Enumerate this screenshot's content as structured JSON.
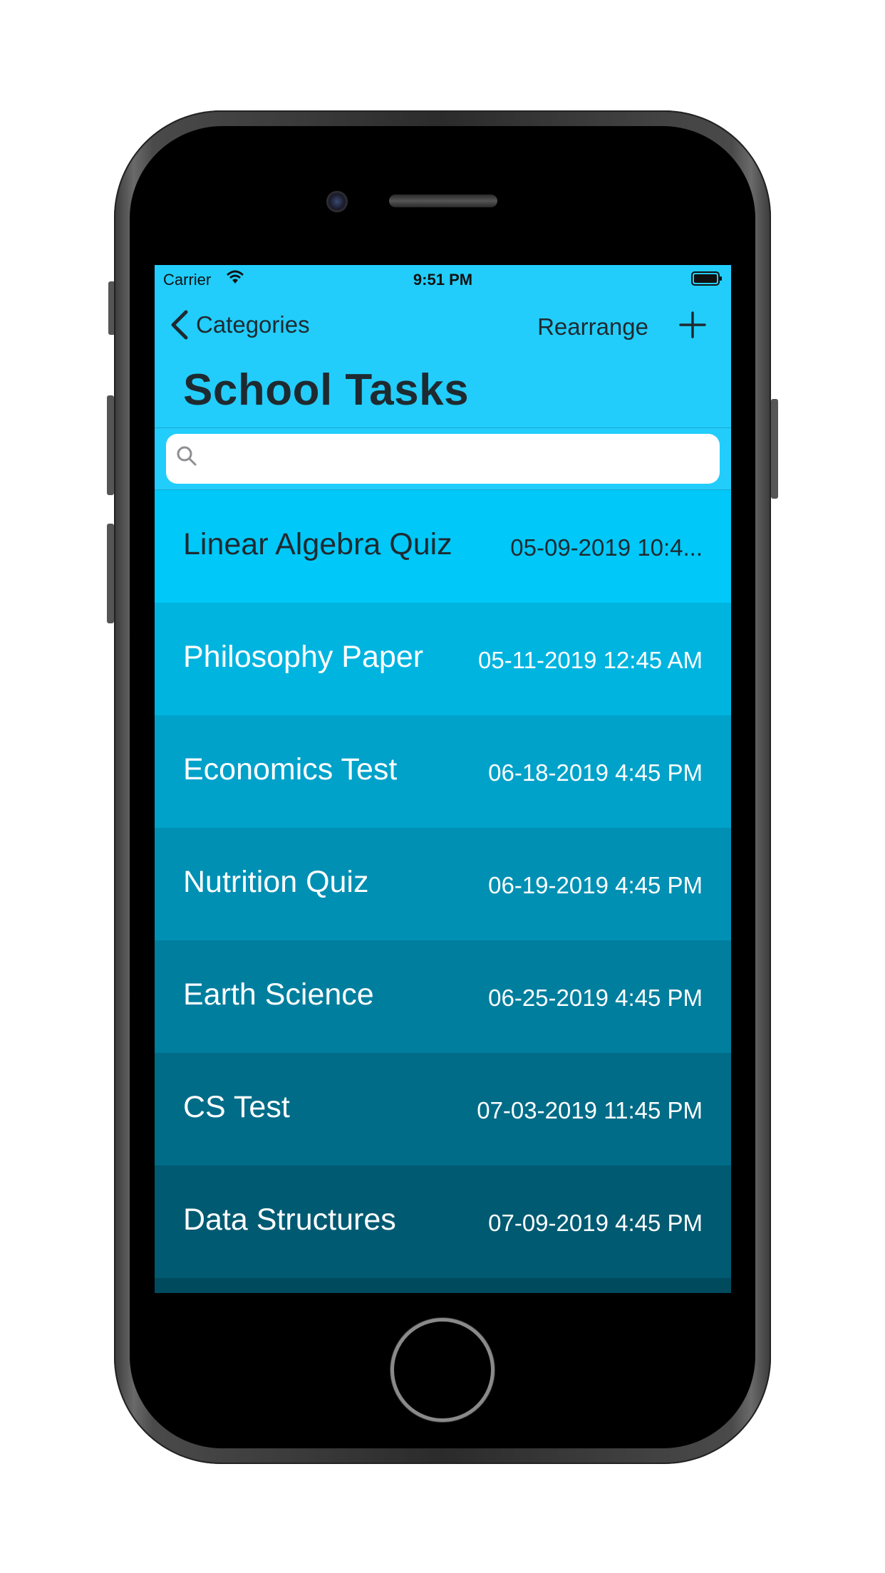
{
  "status_bar": {
    "carrier": "Carrier",
    "time": "9:51 PM"
  },
  "nav": {
    "back_label": "Categories",
    "rearrange_label": "Rearrange",
    "add_label": "+",
    "title": "School Tasks"
  },
  "search": {
    "placeholder": "",
    "value": ""
  },
  "tasks": [
    {
      "name": "Linear Algebra Quiz",
      "date": "05-09-2019 10:4...",
      "bg": "#00c8f8",
      "text": "#1f2a30"
    },
    {
      "name": "Philosophy Paper",
      "date": "05-11-2019 12:45 AM",
      "bg": "#00b4e0",
      "text": "#ffffff"
    },
    {
      "name": "Economics Test",
      "date": "06-18-2019 4:45 PM",
      "bg": "#00a2ca",
      "text": "#ffffff"
    },
    {
      "name": "Nutrition Quiz",
      "date": "06-19-2019 4:45 PM",
      "bg": "#0090b4",
      "text": "#ffffff"
    },
    {
      "name": "Earth Science",
      "date": "06-25-2019 4:45 PM",
      "bg": "#007e9e",
      "text": "#ffffff"
    },
    {
      "name": "CS Test",
      "date": "07-03-2019 11:45 PM",
      "bg": "#006c88",
      "text": "#ffffff"
    },
    {
      "name": "Data Structures",
      "date": "07-09-2019 4:45 PM",
      "bg": "#005a72",
      "text": "#ffffff"
    },
    {
      "name": "",
      "date": "",
      "bg": "#004a5e",
      "text": "#ffffff"
    }
  ],
  "colors": {
    "header_bg": "#22cdfb",
    "nav_text": "#1f2a30",
    "phone_body": "#2b2b2b",
    "bezel": "#000000"
  },
  "icons": {
    "back": "chevron-left-icon",
    "add": "plus-icon",
    "search": "magnifier-icon",
    "wifi": "wifi-icon",
    "battery": "battery-icon"
  }
}
